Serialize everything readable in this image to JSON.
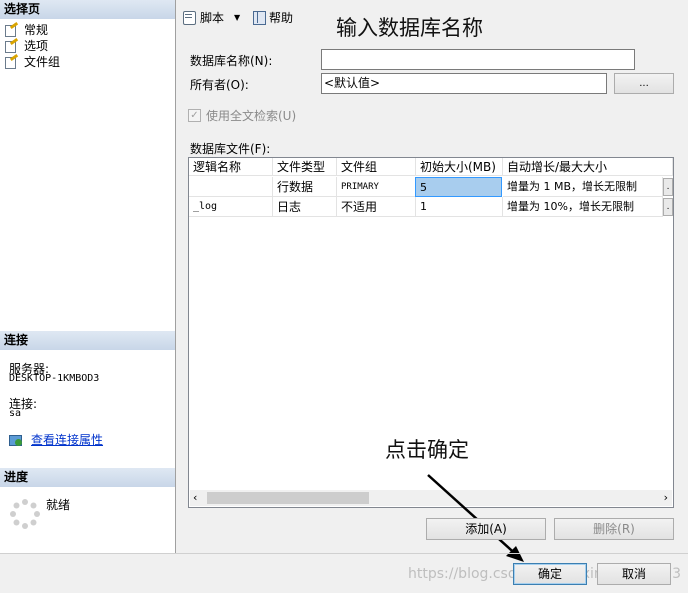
{
  "left_panel": {
    "select_page_header": "选择页",
    "pages": [
      {
        "label": "常规",
        "icon": "page-settings-icon"
      },
      {
        "label": "选项",
        "icon": "page-settings-icon"
      },
      {
        "label": "文件组",
        "icon": "page-settings-icon"
      }
    ],
    "connection_header": "连接",
    "server_label": "服务器:",
    "server_value": "DESKTOP-1KMBOD3",
    "connection_label": "连接:",
    "connection_value": "sa",
    "view_connection_link": "查看连接属性",
    "progress_header": "进度",
    "progress_status": "就绪"
  },
  "toolbar": {
    "script_label": "脚本",
    "help_label": "帮助"
  },
  "annotations": {
    "input_db_name": "输入数据库名称",
    "click_ok": "点击确定",
    "watermark": "https://blog.csdn.net/weixin_51558753"
  },
  "form": {
    "db_name_label": "数据库名称(N):",
    "db_name_value": "",
    "owner_label": "所有者(O):",
    "owner_value": "<默认值>",
    "owner_browse": "...",
    "fulltext_label": "使用全文检索(U)",
    "db_files_label": "数据库文件(F):"
  },
  "grid": {
    "columns": [
      "逻辑名称",
      "文件类型",
      "文件组",
      "初始大小(MB)",
      "自动增长/最大大小"
    ],
    "rows": [
      [
        "",
        "行数据",
        "PRIMARY",
        "5",
        "增量为 1 MB，增长无限制"
      ],
      [
        "_log",
        "日志",
        "不适用",
        "1",
        "增量为 10%，增长无限制"
      ]
    ]
  },
  "buttons": {
    "add": "添加(A)",
    "remove": "删除(R)",
    "ok": "确定",
    "cancel": "取消"
  }
}
